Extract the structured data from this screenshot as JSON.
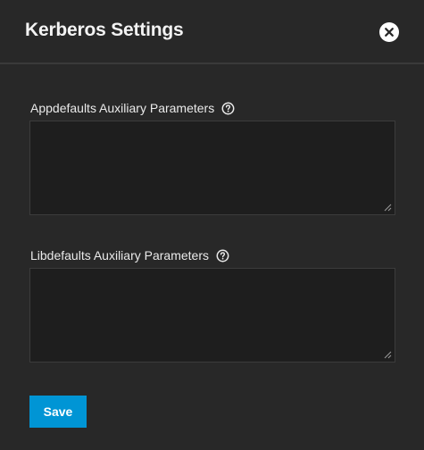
{
  "dialog": {
    "title": "Kerberos Settings"
  },
  "fields": {
    "appdefaults": {
      "label": "Appdefaults Auxiliary Parameters",
      "value": ""
    },
    "libdefaults": {
      "label": "Libdefaults Auxiliary Parameters",
      "value": ""
    }
  },
  "actions": {
    "save_label": "Save"
  },
  "colors": {
    "background": "#282828",
    "input_background": "#1e1e1e",
    "accent": "#0095d5"
  },
  "icons": {
    "close": "close-icon",
    "help": "help-icon",
    "resize": "resize-handle-icon"
  }
}
